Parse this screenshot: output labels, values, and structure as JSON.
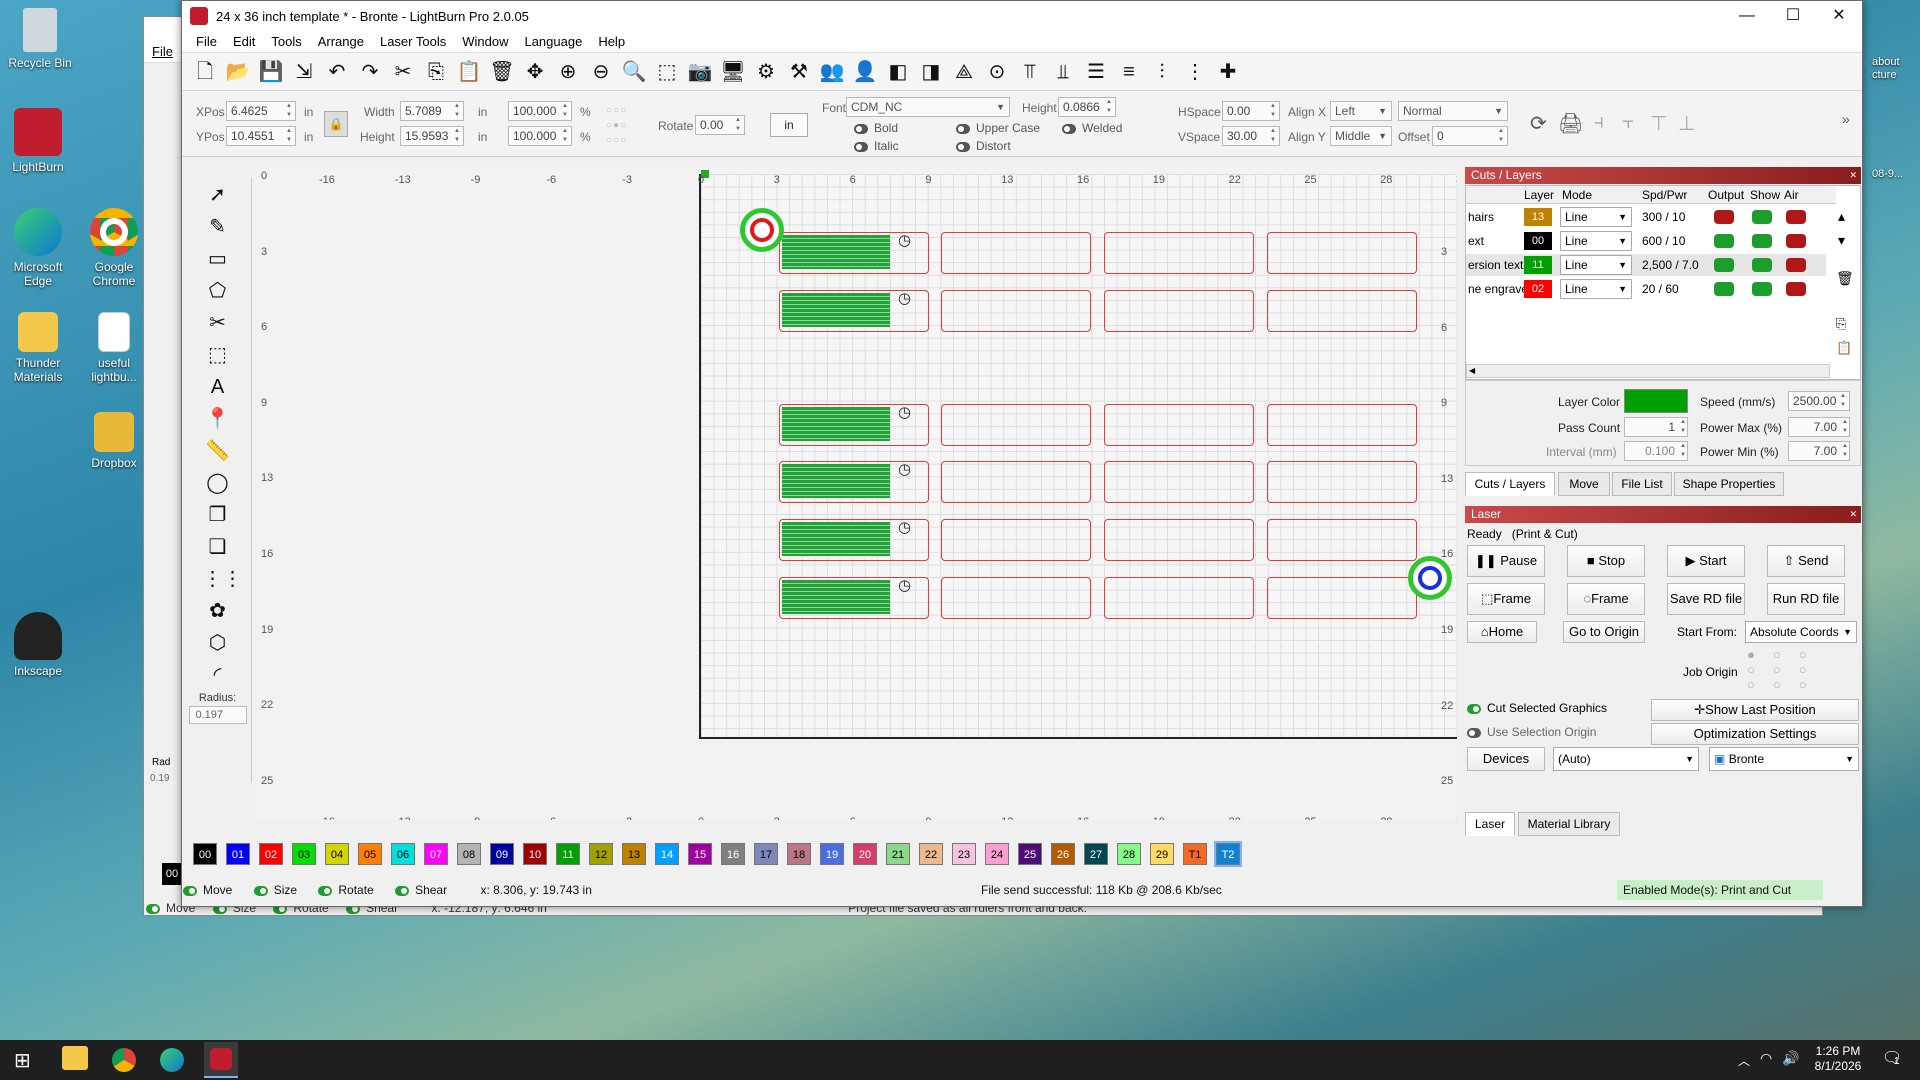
{
  "desktop": {
    "icons": [
      {
        "label": "Recycle Bin",
        "icon": "recycle-bin-icon"
      },
      {
        "label": "LightBurn",
        "icon": "lightburn-icon"
      },
      {
        "label": "Microsoft Edge",
        "icon": "edge-icon"
      },
      {
        "label": "Google Chrome",
        "icon": "chrome-icon"
      },
      {
        "label": "Thunder Materials",
        "icon": "folder-icon"
      },
      {
        "label": "useful lightbu...",
        "icon": "document-icon"
      },
      {
        "label": "Dropbox",
        "icon": "folder-icon"
      },
      {
        "label": "Inkscape",
        "icon": "inkscape-icon"
      }
    ],
    "partial_right": [
      "about",
      "cture",
      "08-9..."
    ]
  },
  "bg_window": {
    "menu": "File",
    "status": {
      "move": "Move",
      "size": "Size",
      "rotate": "Rotate",
      "shear": "Shear",
      "coords": "x: -12.187, y: 6.646 in",
      "message": "Project file saved as all rulers front and back."
    },
    "radius_label": "Rad",
    "radius_value": "0.19",
    "swatch": "00"
  },
  "window": {
    "title": "24 x 36 inch template * - Bronte - LightBurn Pro 2.0.05",
    "menus": [
      "File",
      "Edit",
      "Tools",
      "Arrange",
      "Laser Tools",
      "Window",
      "Language",
      "Help"
    ]
  },
  "props": {
    "xpos_label": "XPos",
    "xpos": "6.4625",
    "ypos_label": "YPos",
    "ypos": "10.4551",
    "unit": "in",
    "width_label": "Width",
    "width": "5.7089",
    "height_label": "Height",
    "height": "15.9593",
    "scale_w": "100.000",
    "scale_h": "100.000",
    "pct": "%",
    "rotate_label": "Rotate",
    "rotate": "0.00",
    "unit_button": "in",
    "font_label": "Font",
    "font": "CDM_NC",
    "font_height_label": "Height",
    "font_height": "0.0866",
    "hspace_label": "HSpace",
    "hspace": "0.00",
    "vspace_label": "VSpace",
    "vspace": "30.00",
    "alignx_label": "Align X",
    "alignx": "Left",
    "aligny_label": "Align Y",
    "aligny": "Middle",
    "style": "Normal",
    "offset_label": "Offset",
    "offset": "0",
    "bold": "Bold",
    "italic": "Italic",
    "upper": "Upper Case",
    "distort": "Distort",
    "welded": "Welded"
  },
  "tools": {
    "radius_label": "Radius:",
    "radius": "0.197"
  },
  "ruler": {
    "x": [
      "-16",
      "-13",
      "-9",
      "-6",
      "-3",
      "0",
      "3",
      "6",
      "9",
      "13",
      "16",
      "19",
      "22",
      "25",
      "28",
      "3"
    ],
    "y_left": [
      "0",
      "3",
      "6",
      "9",
      "13",
      "16",
      "19",
      "22",
      "25"
    ],
    "y_right": [
      "3",
      "6",
      "9",
      "13",
      "16",
      "19",
      "22",
      "25"
    ]
  },
  "palette": [
    {
      "label": "00",
      "color": "#000000",
      "text": "#ffffff"
    },
    {
      "label": "01",
      "color": "#0000ff",
      "text": "#ffffff"
    },
    {
      "label": "02",
      "color": "#ff0000",
      "text": "#ffffff"
    },
    {
      "label": "03",
      "color": "#00e000",
      "text": "#000000"
    },
    {
      "label": "04",
      "color": "#d4d400",
      "text": "#000000"
    },
    {
      "label": "05",
      "color": "#ff8000",
      "text": "#000000"
    },
    {
      "label": "06",
      "color": "#00e0e0",
      "text": "#000000"
    },
    {
      "label": "07",
      "color": "#ff00ff",
      "text": "#ffffff"
    },
    {
      "label": "08",
      "color": "#b4b4b4",
      "text": "#000000"
    },
    {
      "label": "09",
      "color": "#0000a0",
      "text": "#ffffff"
    },
    {
      "label": "10",
      "color": "#a00000",
      "text": "#ffffff"
    },
    {
      "label": "11",
      "color": "#00a000",
      "text": "#ffffff"
    },
    {
      "label": "12",
      "color": "#a0a000",
      "text": "#000000"
    },
    {
      "label": "13",
      "color": "#c08000",
      "text": "#000000"
    },
    {
      "label": "14",
      "color": "#00a0ff",
      "text": "#ffffff"
    },
    {
      "label": "15",
      "color": "#a000a0",
      "text": "#ffffff"
    },
    {
      "label": "16",
      "color": "#808080",
      "text": "#ffffff"
    },
    {
      "label": "17",
      "color": "#7d87b9",
      "text": "#000000"
    },
    {
      "label": "18",
      "color": "#bb7784",
      "text": "#000000"
    },
    {
      "label": "19",
      "color": "#4a6fe3",
      "text": "#ffffff"
    },
    {
      "label": "20",
      "color": "#d33f6a",
      "text": "#ffffff"
    },
    {
      "label": "21",
      "color": "#8cd78c",
      "text": "#000000"
    },
    {
      "label": "22",
      "color": "#f0b98d",
      "text": "#000000"
    },
    {
      "label": "23",
      "color": "#f6c4e1",
      "text": "#000000"
    },
    {
      "label": "24",
      "color": "#fa9ed4",
      "text": "#000000"
    },
    {
      "label": "25",
      "color": "#500a78",
      "text": "#ffffff"
    },
    {
      "label": "26",
      "color": "#b45a00",
      "text": "#ffffff"
    },
    {
      "label": "27",
      "color": "#004754",
      "text": "#ffffff"
    },
    {
      "label": "28",
      "color": "#86fa88",
      "text": "#000000"
    },
    {
      "label": "29",
      "color": "#ffdb66",
      "text": "#000000"
    },
    {
      "label": "T1",
      "color": "#f36926",
      "text": "#000000"
    },
    {
      "label": "T2",
      "color": "#0f82d2",
      "text": "#ffffff"
    }
  ],
  "status": {
    "move": "Move",
    "size": "Size",
    "rotate": "Rotate",
    "shear": "Shear",
    "coords": "x: 8.306, y: 19.743 in",
    "message": "File send successful: 118 Kb @ 208.6 Kb/sec",
    "mode": "Enabled Mode(s): Print and Cut"
  },
  "cuts": {
    "title": "Cuts / Layers",
    "headers": [
      "Layer",
      "Mode",
      "Spd/Pwr",
      "Output",
      "Show",
      "Air"
    ],
    "rows": [
      {
        "name": "hairs",
        "layer": "13",
        "color": "#c08000",
        "mode": "Line",
        "spdpwr": "300 / 10",
        "output": false,
        "show": true,
        "air": false
      },
      {
        "name": "ext",
        "layer": "00",
        "color": "#000000",
        "mode": "Line",
        "spdpwr": "600 / 10",
        "output": true,
        "show": true,
        "air": false
      },
      {
        "name": "ersion text",
        "layer": "11",
        "color": "#00a000",
        "mode": "Line",
        "spdpwr": "2,500 / 7.0",
        "output": true,
        "show": true,
        "air": false
      },
      {
        "name": "ne engrave",
        "layer": "02",
        "color": "#ff0000",
        "mode": "Line",
        "spdpwr": "20 / 60",
        "output": true,
        "show": true,
        "air": false
      }
    ],
    "layer_color_label": "Layer Color",
    "layer_color": "#00a000",
    "speed_label": "Speed (mm/s)",
    "speed": "2500.00",
    "pass_label": "Pass Count",
    "pass": "1",
    "pmax_label": "Power Max (%)",
    "pmax": "7.00",
    "interval_label": "Interval (mm)",
    "interval": "0.100",
    "pmin_label": "Power Min (%)",
    "pmin": "7.00",
    "tabs": [
      "Cuts / Layers",
      "Move",
      "File List",
      "Shape Properties"
    ]
  },
  "laser": {
    "title": "Laser",
    "state": "Ready",
    "mode": "(Print & Cut)",
    "pause": "Pause",
    "stop": "Stop",
    "start": "Start",
    "send": "Send",
    "frame1": "Frame",
    "frame2": "Frame",
    "save_rd": "Save RD file",
    "run_rd": "Run RD file",
    "home": "Home",
    "goto_origin": "Go to Origin",
    "start_from_label": "Start From:",
    "start_from": "Absolute Coords",
    "job_origin_label": "Job Origin",
    "cut_selected": "Cut Selected Graphics",
    "use_selection": "Use Selection Origin",
    "show_last": "Show Last Position",
    "opt_settings": "Optimization Settings",
    "devices": "Devices",
    "port": "(Auto)",
    "device": "Bronte",
    "tabs": [
      "Laser",
      "Material Library"
    ]
  },
  "taskbar": {
    "time": "1:26 PM",
    "date": "8/1/2026",
    "notif": "1"
  }
}
